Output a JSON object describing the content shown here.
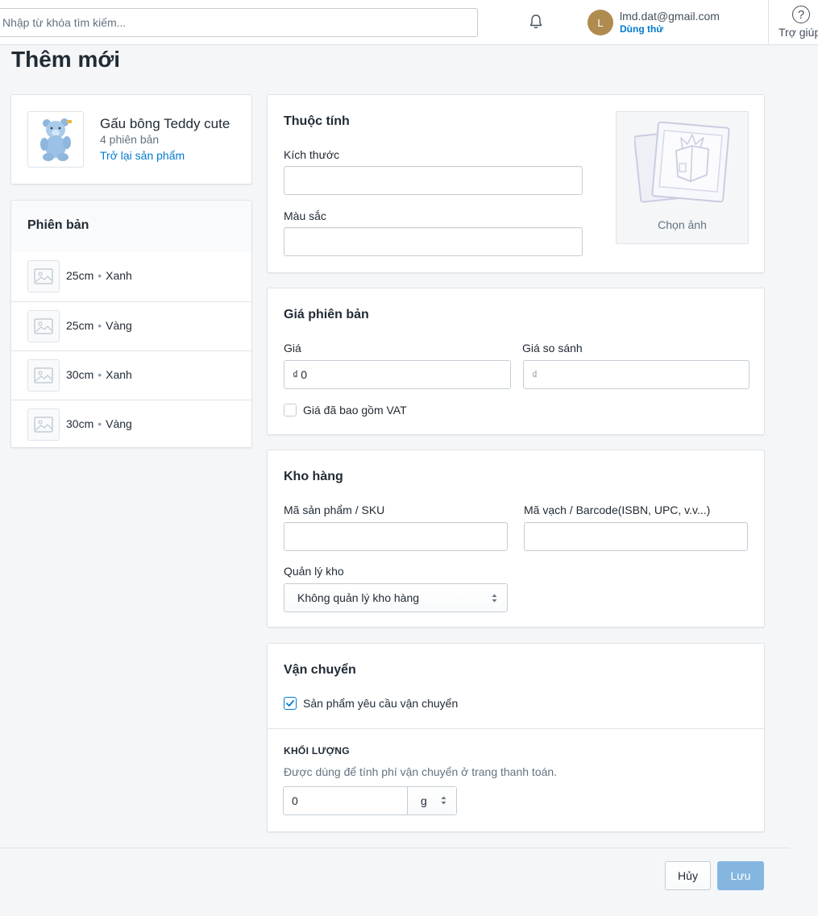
{
  "topbar": {
    "search_placeholder": "Nhập từ khóa tìm kiếm...",
    "user": {
      "initial": "L",
      "email": "lmd.dat@gmail.com",
      "plan": "Dùng thử"
    },
    "help_label": "Trợ giúp"
  },
  "page": {
    "title": "Thêm mới"
  },
  "product": {
    "name": "Gấu bông Teddy cute",
    "variant_count": "4 phiên bản",
    "back_link": "Trở lại sản phẩm"
  },
  "variants": {
    "heading": "Phiên bản",
    "separator": "•",
    "items": [
      {
        "size": "25cm",
        "color": "Xanh"
      },
      {
        "size": "25cm",
        "color": "Vàng"
      },
      {
        "size": "30cm",
        "color": "Xanh"
      },
      {
        "size": "30cm",
        "color": "Vàng"
      }
    ]
  },
  "attributes": {
    "heading": "Thuộc tính",
    "size_label": "Kích thước",
    "size_value": "",
    "color_label": "Màu sắc",
    "color_value": "",
    "image_label": "Chọn ảnh"
  },
  "pricing": {
    "heading": "Giá phiên bản",
    "price_label": "Giá",
    "currency": "₫",
    "price_value": "0",
    "compare_label": "Giá so sánh",
    "compare_value": "",
    "vat_label": "Giá đã bao gồm VAT",
    "vat_checked": false
  },
  "inventory": {
    "heading": "Kho hàng",
    "sku_label": "Mã sản phẩm / SKU",
    "sku_value": "",
    "barcode_label": "Mã vạch / Barcode(ISBN, UPC, v.v...)",
    "barcode_value": "",
    "manage_label": "Quản lý kho",
    "manage_selected": "Không quản lý kho hàng"
  },
  "shipping": {
    "heading": "Vận chuyển",
    "requires_label": "Sản phẩm yêu cầu vận chuyển",
    "requires_checked": true,
    "weight_heading": "KHỐI LƯỢNG",
    "weight_hint": "Được dùng để tính phí vận chuyển ở trang thanh toán.",
    "weight_value": "0",
    "weight_unit": "g"
  },
  "actions": {
    "cancel_label": "Hủy",
    "save_label": "Lưu"
  },
  "colors": {
    "accent": "#007ace",
    "save_disabled": "#84b6e0",
    "avatar": "#b08b4f"
  }
}
